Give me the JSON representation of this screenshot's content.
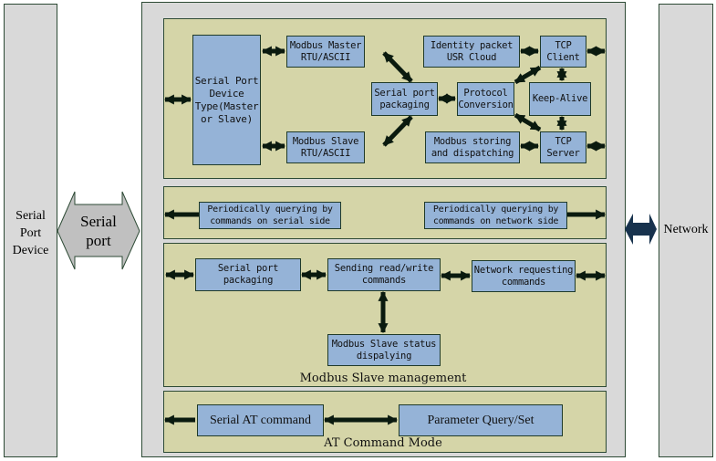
{
  "left_column": {
    "label": "Serial\nPort\nDevice"
  },
  "serial_port_arrow": {
    "label": "Serial\nport"
  },
  "right_column": {
    "label": "Network"
  },
  "panel_network": {
    "device_type": "Serial Port\nDevice\nType(Master\nor Slave)",
    "modbus_master": "Modbus Master\nRTU/ASCII",
    "modbus_slave": "Modbus Slave\nRTU/ASCII",
    "serial_port_packaging": "Serial port\npackaging",
    "protocol_conversion": "Protocol\nConversion",
    "identity_packet": "Identity packet\nUSR Cloud",
    "tcp_client": "TCP\nClient",
    "keep_alive": "Keep-Alive",
    "modbus_storing": "Modbus storing\nand dispatching",
    "tcp_server": "TCP\nServer"
  },
  "panel_polling": {
    "serial_side": "Periodically querying by\ncommands on serial side",
    "network_side": "Periodically querying by\ncommands on network side"
  },
  "panel_slave": {
    "title": "Modbus Slave management",
    "serial_port_packaging": "Serial port\npackaging",
    "sending": "Sending read/write\ncommands",
    "network_requesting": "Network requesting\ncommands",
    "status": "Modbus Slave status\ndispalying"
  },
  "panel_at": {
    "title": "AT Command Mode",
    "serial_at": "Serial AT command",
    "parameter": "Parameter Query/Set"
  },
  "colors": {
    "box": "#95b3d7",
    "panel": "#d5d5a8",
    "column": "#d9d9d9",
    "network_arrow": "#17324d"
  }
}
